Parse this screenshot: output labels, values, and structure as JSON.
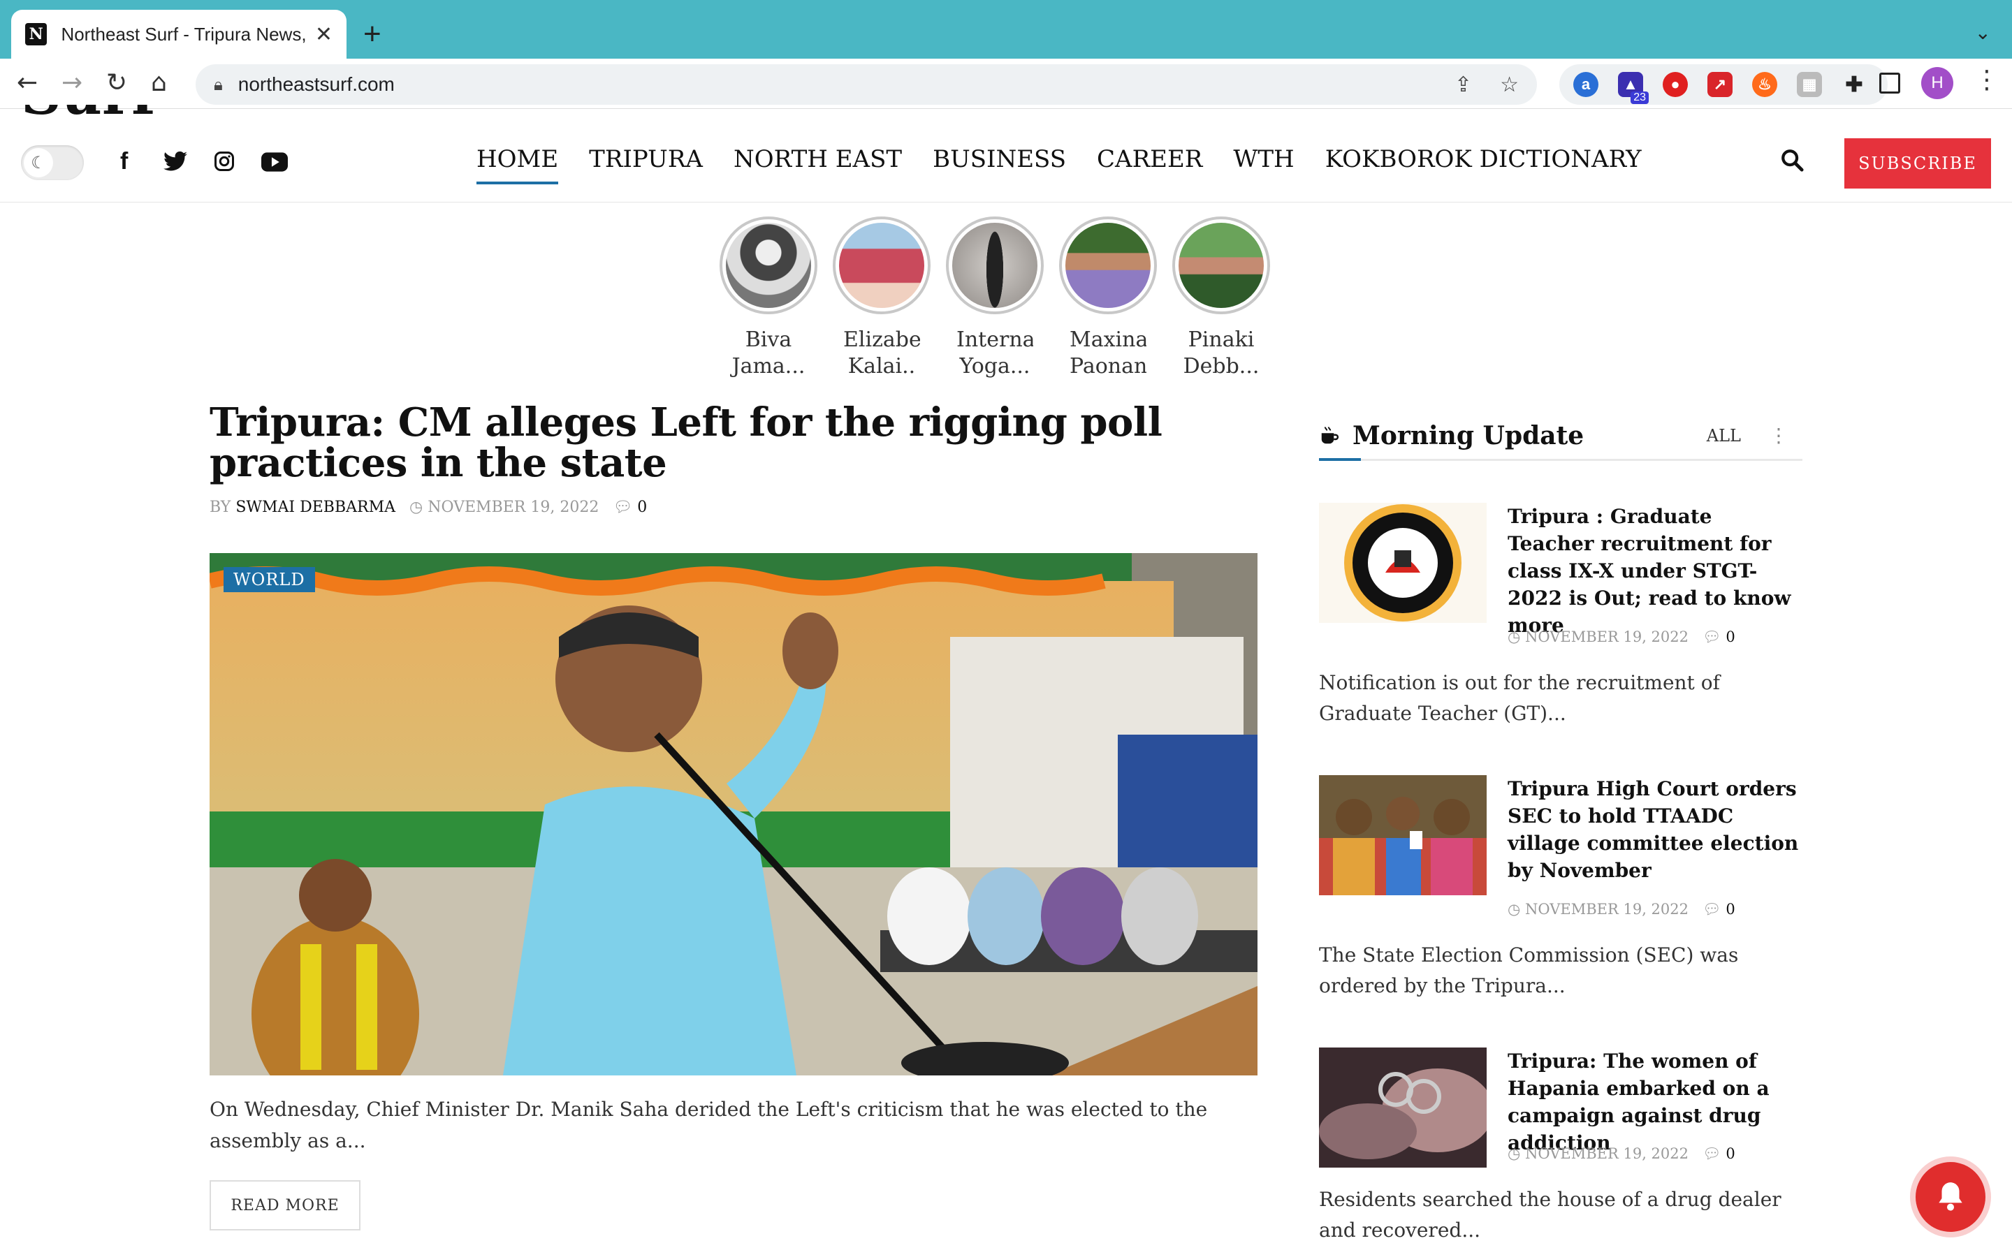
{
  "browser": {
    "tab_title": "Northeast Surf - Tripura News, ",
    "favicon_letter": "N",
    "url": "northeastsurf.com",
    "extension_badge": "23",
    "profile_initial": "H"
  },
  "site": {
    "logo_text": "Surf",
    "nav": [
      "HOME",
      "TRIPURA",
      "NORTH EAST",
      "BUSINESS",
      "CAREER",
      "WTH",
      "KOKBOROK DICTIONARY"
    ],
    "subscribe_label": "SUBSCRIBE"
  },
  "stories": [
    {
      "line1": "Biva",
      "line2": "Jama..."
    },
    {
      "line1": "Elizabe",
      "line2": "Kalai.."
    },
    {
      "line1": "Interna",
      "line2": "Yoga..."
    },
    {
      "line1": "Maxina",
      "line2": "Paonan"
    },
    {
      "line1": "Pinaki",
      "line2": "Debb..."
    }
  ],
  "article": {
    "title": "Tripura: CM alleges Left for the rigging poll practices in the state",
    "by_label": "BY",
    "author": "SWMAI DEBBARMA",
    "date": "NOVEMBER 19, 2022",
    "comments": "0",
    "category": "WORLD",
    "excerpt": "On Wednesday, Chief Minister Dr. Manik Saha derided the Left's criticism that he was elected to the assembly as a...",
    "read_more": "READ MORE"
  },
  "sidebar": {
    "block_title": "Morning Update",
    "all_label": "ALL",
    "posts": [
      {
        "title": "Tripura : Graduate Teacher recruitment for class IX-X under STGT-2022 is Out; read to know more",
        "date": "NOVEMBER 19, 2022",
        "comments": "0",
        "excerpt": "Notification is out for the recruitment of Graduate Teacher (GT)..."
      },
      {
        "title": "Tripura High Court orders SEC to hold TTAADC village committee election by November",
        "date": "NOVEMBER 19, 2022",
        "comments": "0",
        "excerpt": "The State Election Commission (SEC) was ordered by the Tripura..."
      },
      {
        "title": "Tripura: The women of Hapania embarked on a campaign against drug addiction",
        "date": "NOVEMBER 19, 2022",
        "comments": "0",
        "excerpt": "Residents searched the house of a drug dealer and recovered..."
      }
    ]
  },
  "colors": {
    "tabbar": "#4ab7c4",
    "accent": "#1d6fa5",
    "subscribe": "#e6323c"
  }
}
